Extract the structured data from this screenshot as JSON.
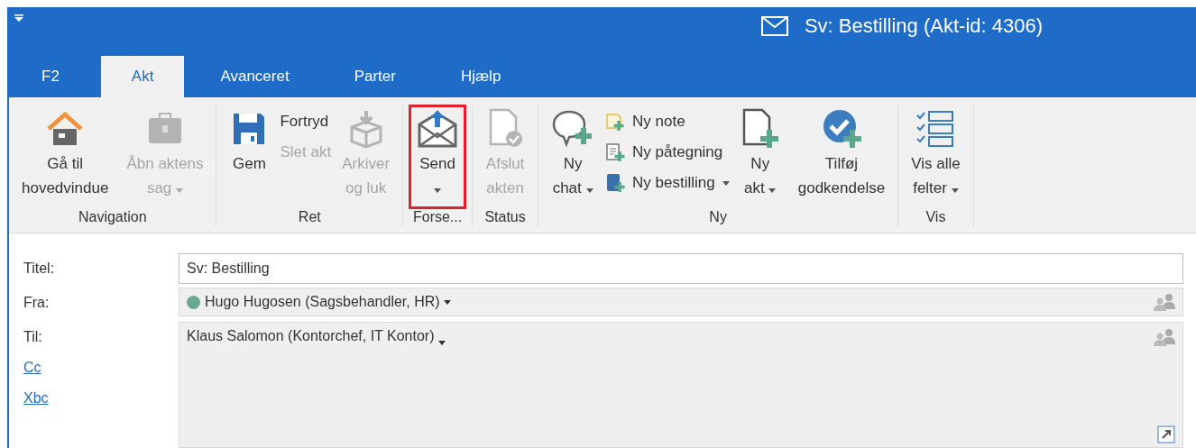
{
  "window": {
    "title": "Sv: Bestilling (Akt-id: 4306)"
  },
  "tabs": [
    {
      "label": "F2",
      "selected": false
    },
    {
      "label": "Akt",
      "selected": true
    },
    {
      "label": "Avanceret",
      "selected": false
    },
    {
      "label": "Parter",
      "selected": false
    },
    {
      "label": "Hjælp",
      "selected": false
    }
  ],
  "ribbon": {
    "groups": [
      {
        "label": "Navigation",
        "items": [
          {
            "kind": "large",
            "lines": [
              "Gå til",
              "hovedvindue"
            ],
            "disabled": false,
            "dropdown": false,
            "highlighted": false
          },
          {
            "kind": "large",
            "lines": [
              "Åbn aktens",
              "sag"
            ],
            "disabled": true,
            "dropdown": true,
            "highlighted": false
          }
        ]
      },
      {
        "label": "Ret",
        "items": [
          {
            "kind": "large",
            "lines": [
              "Gem"
            ],
            "disabled": false,
            "dropdown": false,
            "highlighted": false
          },
          {
            "kind": "stack",
            "buttons": [
              {
                "label": "Fortryd",
                "disabled": false,
                "dropdown": false
              },
              {
                "label": "Slet akt",
                "disabled": true,
                "dropdown": false
              }
            ]
          },
          {
            "kind": "large",
            "lines": [
              "Arkiver",
              "og luk"
            ],
            "disabled": true,
            "dropdown": false,
            "highlighted": false
          }
        ]
      },
      {
        "label": "Forse...",
        "items": [
          {
            "kind": "large",
            "lines": [
              "Send"
            ],
            "disabled": false,
            "dropdown": true,
            "highlighted": true
          }
        ]
      },
      {
        "label": "Status",
        "items": [
          {
            "kind": "large",
            "lines": [
              "Afslut",
              "akten"
            ],
            "disabled": true,
            "dropdown": false,
            "highlighted": false
          }
        ]
      },
      {
        "label": "Ny",
        "items": [
          {
            "kind": "large",
            "lines": [
              "Ny",
              "chat"
            ],
            "disabled": false,
            "dropdown": true,
            "highlighted": false
          },
          {
            "kind": "stack",
            "buttons": [
              {
                "label": "Ny note",
                "disabled": false,
                "dropdown": false
              },
              {
                "label": "Ny påtegning",
                "disabled": false,
                "dropdown": false
              },
              {
                "label": "Ny bestilling",
                "disabled": false,
                "dropdown": true
              }
            ]
          },
          {
            "kind": "large",
            "lines": [
              "Ny",
              "akt"
            ],
            "disabled": false,
            "dropdown": true,
            "highlighted": false
          },
          {
            "kind": "large",
            "lines": [
              "Tilføj",
              "godkendelse"
            ],
            "disabled": false,
            "dropdown": false,
            "highlighted": false
          }
        ]
      },
      {
        "label": "Vis",
        "items": [
          {
            "kind": "large",
            "lines": [
              "Vis alle",
              "felter"
            ],
            "disabled": false,
            "dropdown": true,
            "highlighted": false
          }
        ]
      }
    ]
  },
  "form": {
    "fields": [
      {
        "kind": "text",
        "label": "Titel:",
        "value": "Sv: Bestilling"
      },
      {
        "kind": "sender",
        "label": "Fra:",
        "value": "Hugo Hugosen (Sagsbehandler, HR)",
        "color": "#6aa98f"
      },
      {
        "kind": "recipients",
        "label": "Til:",
        "value": "Klaus Salomon (Kontorchef, IT Kontor)",
        "links": [
          "Cc",
          "Xbc"
        ]
      }
    ]
  }
}
